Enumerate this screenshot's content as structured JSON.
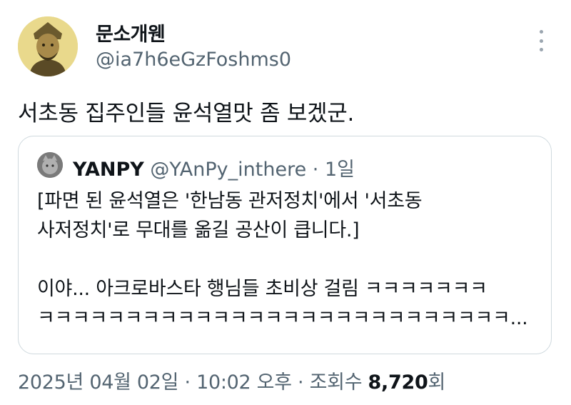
{
  "author": {
    "display_name": "문소개웬",
    "handle": "@ia7h6eGzFoshms0"
  },
  "tweet": {
    "text": "서초동 집주인들 윤석열맛 좀 보겠군."
  },
  "quoted_tweet": {
    "display_name": "YANPY",
    "handle": "@YAnPy_inthere",
    "separator": "·",
    "time": "1일",
    "body_lines": [
      "[파면 된 윤석열은 '한남동 관저정치'에서 '서초동",
      "사저정치'로 무대를 옮길 공산이 큽니다.]",
      "이야... 아크로바스타 행님들 초비상 걸림 ㅋㅋㅋㅋㅋㅋㅋ",
      "ㅋㅋㅋㅋㅋㅋㅋㅋㅋㅋㅋㅋㅋㅋㅋㅋㅋㅋㅋㅋㅋㅋㅋㅋㅋㅋㅋ..."
    ]
  },
  "meta": {
    "date": "2025년 04월 02일",
    "sep1": " · ",
    "time": "10:02 오후",
    "sep2": " · ",
    "views_label": "조회수 ",
    "views_count": "8,720",
    "views_suffix": "회"
  },
  "icons": {
    "more": "more-vertical-icon"
  },
  "colors": {
    "text": "#0f1419",
    "secondary": "#536471",
    "border": "#cfd9de"
  }
}
